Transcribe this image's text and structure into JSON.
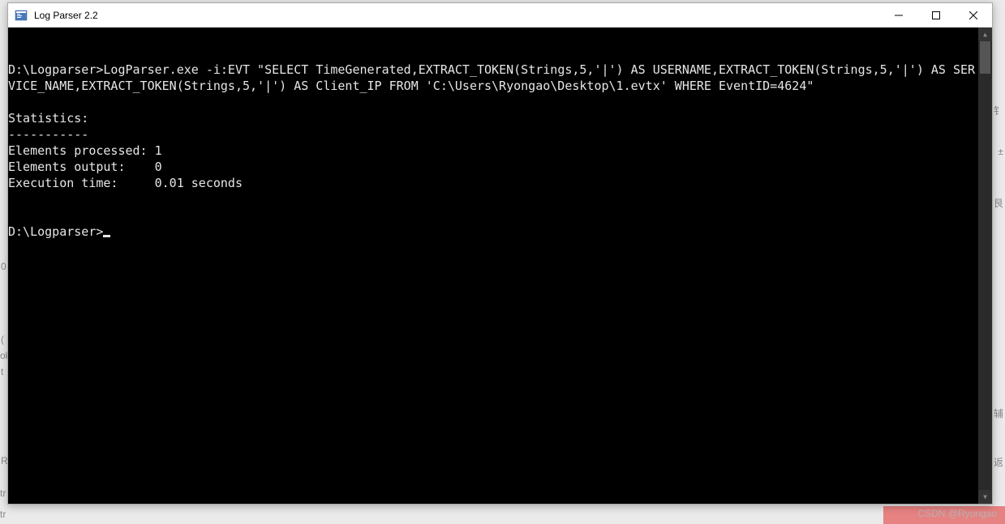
{
  "window": {
    "title": "Log Parser 2.2"
  },
  "terminal": {
    "prompt1": "D:\\Logparser>",
    "command": "LogParser.exe -i:EVT \"SELECT TimeGenerated,EXTRACT_TOKEN(Strings,5,'|') AS USERNAME,EXTRACT_TOKEN(Strings,5,'|') AS SERVICE_NAME,EXTRACT_TOKEN(Strings,5,'|') AS Client_IP FROM 'C:\\Users\\Ryongao\\Desktop\\1.evtx' WHERE EventID=4624\"",
    "stats_header": "Statistics:",
    "stats_divider": "-----------",
    "stats_processed": "Elements processed: 1",
    "stats_output": "Elements output:    0",
    "stats_time": "Execution time:     0.01 seconds",
    "prompt2": "D:\\Logparser>"
  },
  "watermark": "CSDN @Ryongao",
  "bg_fragments": {
    "a": "0",
    "b": "(",
    "c": "ok",
    "d": "t",
    "e": "R",
    "f": "tr",
    "g": "tr"
  }
}
